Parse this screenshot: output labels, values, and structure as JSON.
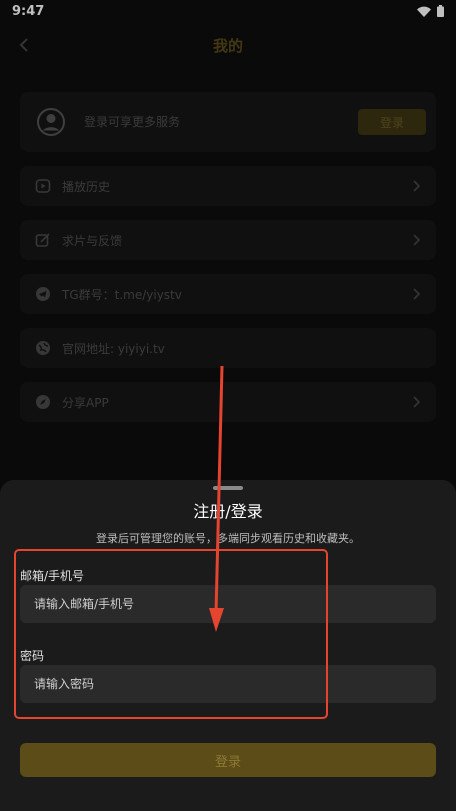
{
  "status_bar": {
    "time": "9:47"
  },
  "header": {
    "title": "我的"
  },
  "user_card": {
    "prompt": "登录可享更多服务",
    "login_label": "登录"
  },
  "menu": {
    "items": [
      {
        "label": "播放历史",
        "icon": "play-history-icon"
      },
      {
        "label": "求片与反馈",
        "icon": "edit-feedback-icon"
      },
      {
        "label": "TG群号：t.me/yiystv",
        "icon": "telegram-icon"
      },
      {
        "label": "官网地址: yiyiyi.tv",
        "icon": "globe-icon"
      },
      {
        "label": "分享APP",
        "icon": "share-compass-icon"
      }
    ]
  },
  "sheet": {
    "title": "注册/登录",
    "subtitle": "登录后可管理您的账号，多端同步观看历史和收藏夹。",
    "account": {
      "label": "邮箱/手机号",
      "placeholder": "请输入邮箱/手机号"
    },
    "password": {
      "label": "密码",
      "placeholder": "请输入密码"
    },
    "submit_label": "登录"
  },
  "colors": {
    "accent": "#5b4c18",
    "annotation": "#e5452f",
    "sheet_bg": "#1b1b1b"
  }
}
